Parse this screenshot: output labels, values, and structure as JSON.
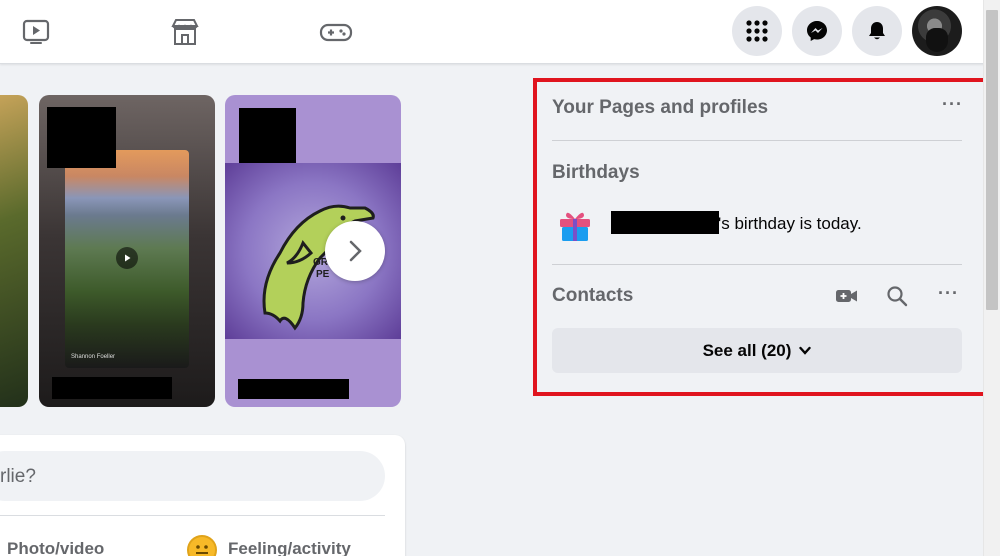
{
  "right_panel": {
    "pages_title": "Your Pages and profiles",
    "birthdays_title": "Birthdays",
    "birthday_text": "'s birthday is today.",
    "contacts_title": "Contacts",
    "see_all_label": "See all (20)"
  },
  "composer": {
    "placeholder": "rlie?",
    "photo_label": "Photo/video",
    "feeling_label": "Feeling/activity"
  },
  "stories": {
    "caption": "Shannon Foeller",
    "dolphin_text_1": "GR",
    "dolphin_text_2": "PE"
  },
  "colors": {
    "highlight": "#e0141e",
    "accent": "#1877f2"
  }
}
